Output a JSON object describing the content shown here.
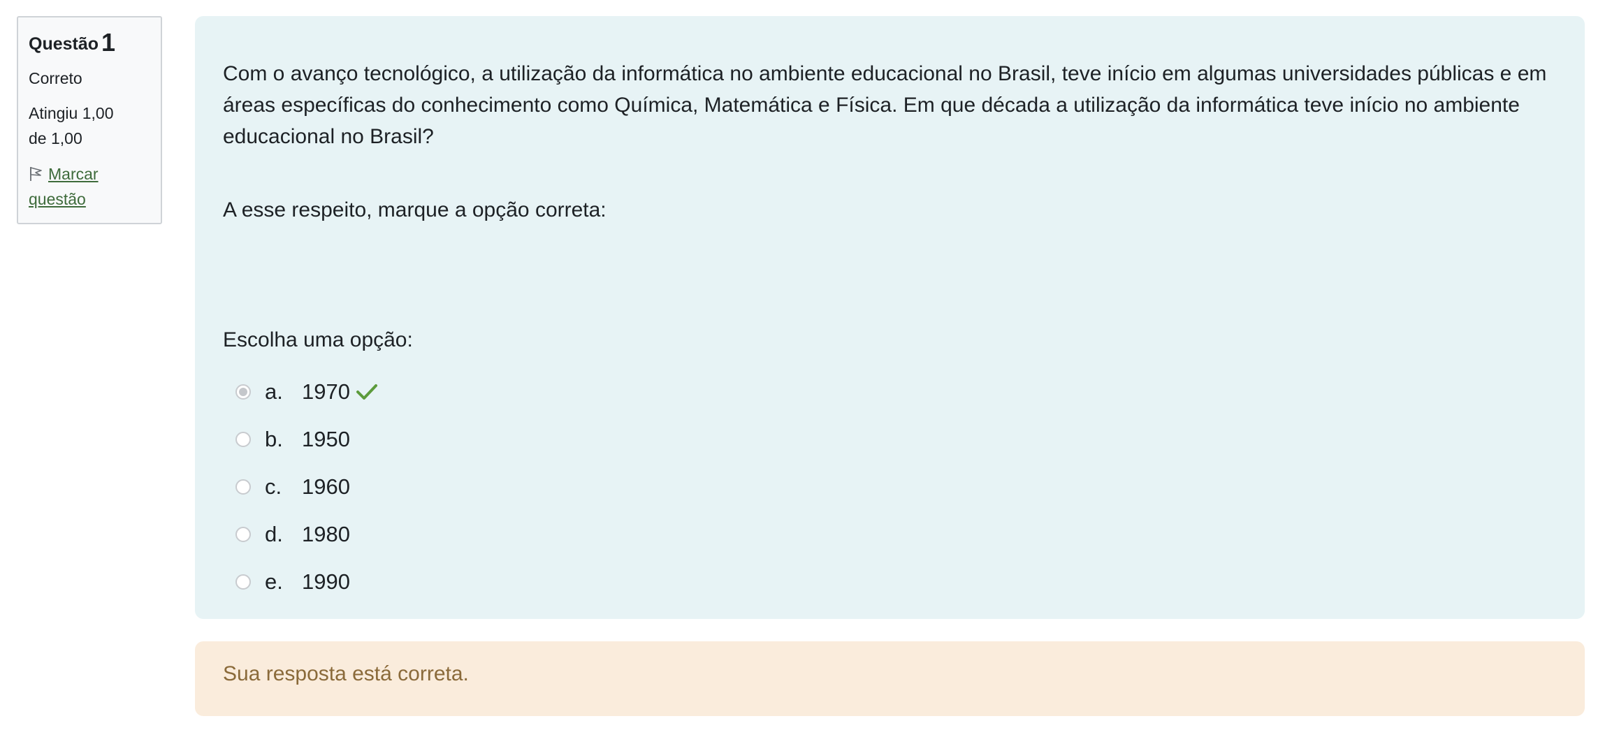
{
  "info": {
    "question_label": "Questão",
    "question_number": "1",
    "state": "Correto",
    "grade_line1": "Atingiu 1,00",
    "grade_line2": "de 1,00",
    "flag_line1": "Marcar",
    "flag_line2": "questão",
    "flag_icon": "flag-icon"
  },
  "question": {
    "paragraph1": "Com o avanço tecnológico, a utilização da informática no ambiente educacional no Brasil, teve início em algumas universidades públicas e em áreas específicas do conhecimento como Química, Matemática e Física. Em que década a utilização da informática teve início no ambiente educacional no Brasil?",
    "paragraph2": "A esse respeito, marque a opção correta:",
    "prompt": "Escolha uma opção:",
    "answers": [
      {
        "letter": "a.",
        "value": "1970",
        "selected": true,
        "correct": true
      },
      {
        "letter": "b.",
        "value": "1950",
        "selected": false,
        "correct": false
      },
      {
        "letter": "c.",
        "value": "1960",
        "selected": false,
        "correct": false
      },
      {
        "letter": "d.",
        "value": "1980",
        "selected": false,
        "correct": false
      },
      {
        "letter": "e.",
        "value": "1990",
        "selected": false,
        "correct": false
      }
    ],
    "correct_icon": "check-icon",
    "correct_color": "#5c9b3c"
  },
  "feedback": {
    "text": "Sua resposta está correta."
  }
}
